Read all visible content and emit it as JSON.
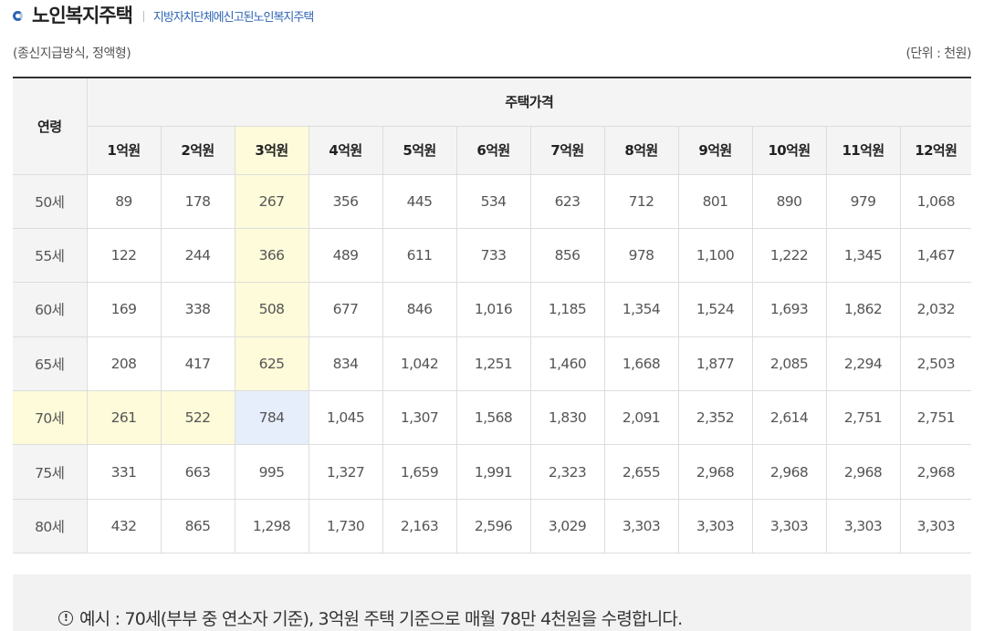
{
  "header": {
    "title": "노인복지주택",
    "subtitle": "지방자치단체에신고된노인복지주택"
  },
  "meta": {
    "method": "(종신지급방식, 정액형)",
    "unit": "(단위 : 천원)"
  },
  "table": {
    "age_header": "연령",
    "price_header": "주택가격",
    "columns": [
      "1억원",
      "2억원",
      "3억원",
      "4억원",
      "5억원",
      "6억원",
      "7억원",
      "8억원",
      "9억원",
      "10억원",
      "11억원",
      "12억원"
    ],
    "rows": [
      {
        "age": "50세",
        "values": [
          "89",
          "178",
          "267",
          "356",
          "445",
          "534",
          "623",
          "712",
          "801",
          "890",
          "979",
          "1,068"
        ]
      },
      {
        "age": "55세",
        "values": [
          "122",
          "244",
          "366",
          "489",
          "611",
          "733",
          "856",
          "978",
          "1,100",
          "1,222",
          "1,345",
          "1,467"
        ]
      },
      {
        "age": "60세",
        "values": [
          "169",
          "338",
          "508",
          "677",
          "846",
          "1,016",
          "1,185",
          "1,354",
          "1,524",
          "1,693",
          "1,862",
          "2,032"
        ]
      },
      {
        "age": "65세",
        "values": [
          "208",
          "417",
          "625",
          "834",
          "1,042",
          "1,251",
          "1,460",
          "1,668",
          "1,877",
          "2,085",
          "2,294",
          "2,503"
        ]
      },
      {
        "age": "70세",
        "values": [
          "261",
          "522",
          "784",
          "1,045",
          "1,307",
          "1,568",
          "1,830",
          "2,091",
          "2,352",
          "2,614",
          "2,751",
          "2,751"
        ]
      },
      {
        "age": "75세",
        "values": [
          "331",
          "663",
          "995",
          "1,327",
          "1,659",
          "1,991",
          "2,323",
          "2,655",
          "2,968",
          "2,968",
          "2,968",
          "2,968"
        ]
      },
      {
        "age": "80세",
        "values": [
          "432",
          "865",
          "1,298",
          "1,730",
          "2,163",
          "2,596",
          "3,029",
          "3,303",
          "3,303",
          "3,303",
          "3,303",
          "3,303"
        ]
      }
    ],
    "highlight_column": "3억원",
    "highlight_row": "70세",
    "colors": {
      "highlight_yellow": "#fdfbd9",
      "highlight_blue": "#e7eefb",
      "header_bg": "#f4f4f4",
      "accent": "#2d64b4"
    }
  },
  "note": {
    "icon": "info-circle-icon",
    "text": "예시 : 70세(부부 중 연소자 기준), 3억원 주택 기준으로 매월 78만 4천원을 수령합니다."
  }
}
